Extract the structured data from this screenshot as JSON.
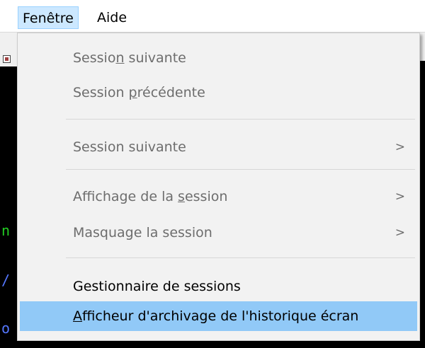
{
  "menubar": {
    "items": [
      {
        "label": "Fenêtre",
        "state": "open"
      },
      {
        "label": "Aide",
        "state": "normal"
      }
    ]
  },
  "dropdown": {
    "items": [
      {
        "pre": "Sessio",
        "mn": "n",
        "post": " suivante",
        "enabled": false,
        "submenu": false
      },
      {
        "pre": "Session ",
        "mn": "p",
        "post": "récédente",
        "enabled": false,
        "submenu": false
      },
      {
        "pre": "Session suivante",
        "mn": "",
        "post": "",
        "enabled": false,
        "submenu": true
      },
      {
        "pre": "Affichage de la ",
        "mn": "s",
        "post": "ession",
        "enabled": false,
        "submenu": true
      },
      {
        "pre": "Masquage la session",
        "mn": "",
        "post": "",
        "enabled": false,
        "submenu": true
      },
      {
        "pre": "Gestionnaire de sessions",
        "mn": "",
        "post": "",
        "enabled": true,
        "submenu": false
      },
      {
        "pre": "",
        "mn": "A",
        "post": "fficheur d'archivage de l'historique écran",
        "enabled": true,
        "submenu": false,
        "highlighted": true
      }
    ],
    "submenu_glyph": ">"
  },
  "background_chars": [
    {
      "char": "n",
      "color": "#22cc22"
    },
    {
      "char": "/",
      "color": "#5577ff"
    },
    {
      "char": "o",
      "color": "#5577ff"
    }
  ],
  "colors": {
    "menubar_open": "#cce8ff",
    "highlight": "#91c9f7",
    "disabled_text": "#6d6d6d"
  }
}
